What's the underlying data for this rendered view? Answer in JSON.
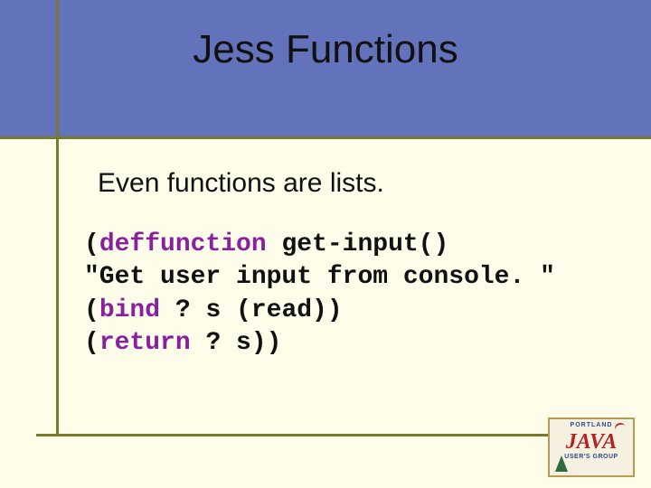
{
  "title": "Jess Functions",
  "subtitle": "Even functions are lists.",
  "code": {
    "l1_kw": "deffunction",
    "l1_rest": " get-input()",
    "l2": "\"Get user input from console. \"",
    "l3_open": "(",
    "l3_kw": "bind",
    "l3_rest": " ? s (read))",
    "l4_open": "(",
    "l4_kw": "return",
    "l4_rest": " ? s))"
  },
  "logo": {
    "line1": "PORTLAND",
    "line2": "JAVA",
    "line3": "USER'S GROUP"
  }
}
